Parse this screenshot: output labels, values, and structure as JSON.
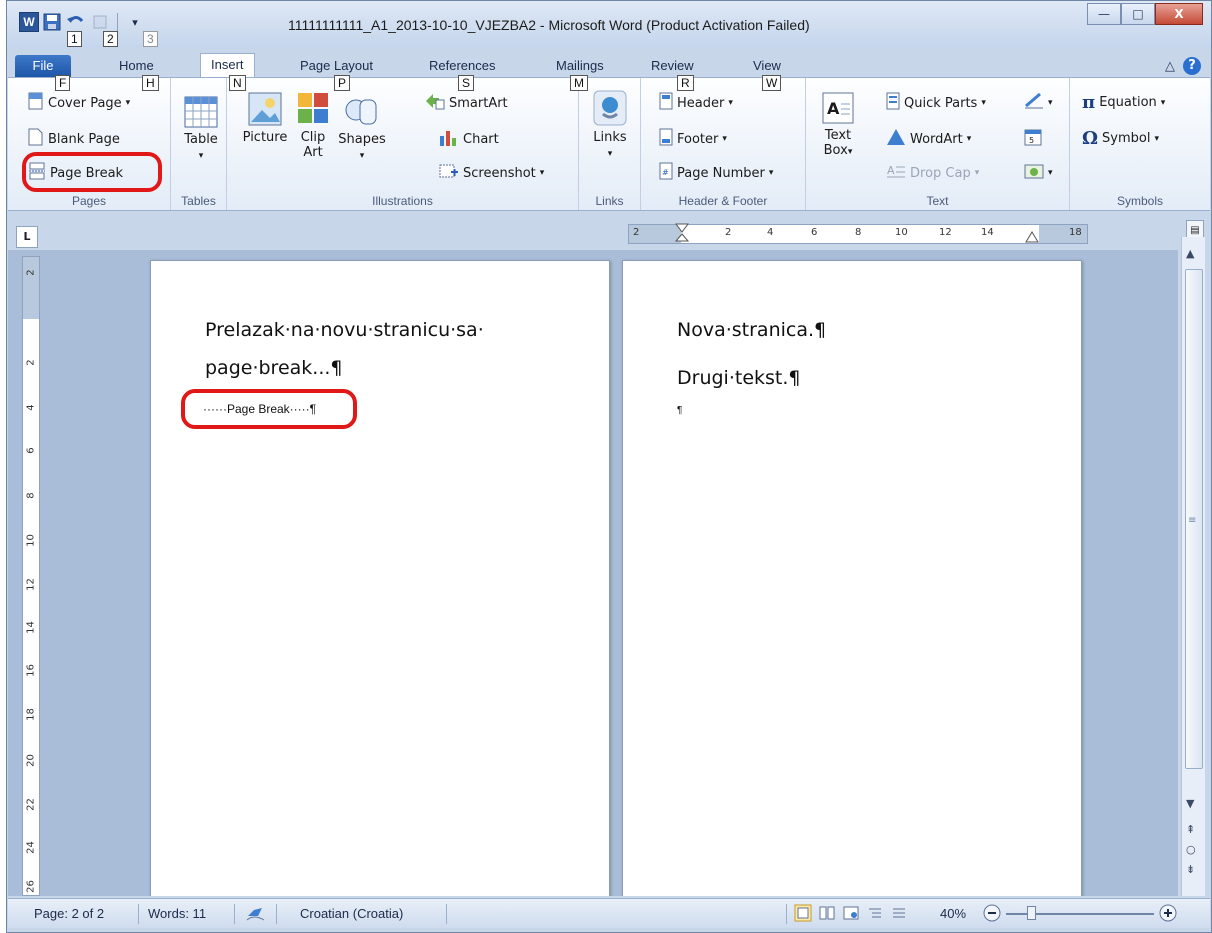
{
  "window": {
    "title": "11111111111_A1_2013-10-10_VJEZBA2 - Microsoft Word (Product Activation Failed)",
    "minimize_label": "—",
    "maximize_label": "□",
    "close_label": "X"
  },
  "quick_access": {
    "logo_label": "W",
    "keytips": [
      "1",
      "2",
      "3"
    ]
  },
  "tabs": [
    {
      "label": "File",
      "keytip": "F"
    },
    {
      "label": "Home",
      "keytip": "H"
    },
    {
      "label": "Insert",
      "keytip": "N"
    },
    {
      "label": "Page Layout",
      "keytip": "P"
    },
    {
      "label": "References",
      "keytip": "S"
    },
    {
      "label": "Mailings",
      "keytip": "M"
    },
    {
      "label": "Review",
      "keytip": "R"
    },
    {
      "label": "View",
      "keytip": "W"
    }
  ],
  "active_tab": "Insert",
  "ribbon": {
    "pages": {
      "label": "Pages",
      "cover_page": "Cover Page",
      "blank_page": "Blank Page",
      "page_break": "Page Break"
    },
    "tables": {
      "label": "Tables",
      "table": "Table"
    },
    "illustrations": {
      "label": "Illustrations",
      "picture": "Picture",
      "clip_art_1": "Clip",
      "clip_art_2": "Art",
      "shapes": "Shapes",
      "smartart": "SmartArt",
      "chart": "Chart",
      "screenshot": "Screenshot"
    },
    "links": {
      "label": "Links",
      "links": "Links"
    },
    "header_footer": {
      "label": "Header & Footer",
      "header": "Header",
      "footer": "Footer",
      "page_number": "Page Number"
    },
    "text": {
      "label": "Text",
      "text_box_1": "Text",
      "text_box_2": "Box",
      "quick_parts": "Quick Parts",
      "wordart": "WordArt",
      "drop_cap": "Drop Cap"
    },
    "symbols": {
      "label": "Symbols",
      "equation": "Equation",
      "symbol": "Symbol"
    }
  },
  "ruler": {
    "tab_selector": "L",
    "h_numbers": [
      "2",
      "2",
      "4",
      "6",
      "8",
      "10",
      "12",
      "14",
      "18"
    ],
    "v_numbers": [
      "2",
      "2",
      "4",
      "6",
      "8",
      "10",
      "12",
      "14",
      "16",
      "18",
      "20",
      "22",
      "24",
      "26"
    ]
  },
  "document": {
    "page1": {
      "line1": "Prelazak·na·novu·stranicu·sa·",
      "line2": "page·break...¶",
      "page_break_marker": "······Page Break·····¶"
    },
    "page2": {
      "line1": "Nova·stranica.¶",
      "line2": "Drugi·tekst.¶",
      "line3": "¶"
    }
  },
  "statusbar": {
    "page": "Page: 2 of 2",
    "words": "Words: 11",
    "language": "Croatian (Croatia)",
    "zoom": "40%",
    "zoom_level_percent": 40
  }
}
